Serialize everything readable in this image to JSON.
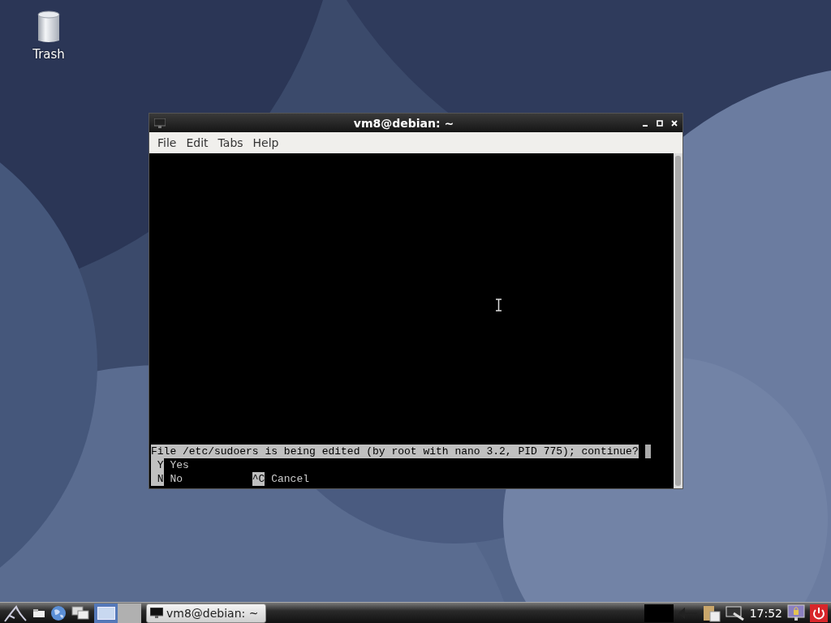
{
  "desktop": {
    "icons": [
      {
        "label": "Trash"
      }
    ]
  },
  "window": {
    "title": "vm8@debian: ~",
    "menu": [
      "File",
      "Edit",
      "Tabs",
      "Help"
    ],
    "terminal": {
      "prompt": "File /etc/sudoers is being edited (by root with nano 3.2, PID 775); continue?",
      "rows": [
        [
          {
            "key": "Y",
            "label": "Yes"
          }
        ],
        [
          {
            "key": "N",
            "label": "No"
          },
          {
            "key": "^C",
            "label": "Cancel"
          }
        ]
      ]
    }
  },
  "taskbar": {
    "pager": [
      {
        "selected": true
      },
      {
        "selected": false
      }
    ],
    "tasks": [
      {
        "label": "vm8@debian: ~",
        "selected": true
      }
    ],
    "clock": "17:52"
  }
}
